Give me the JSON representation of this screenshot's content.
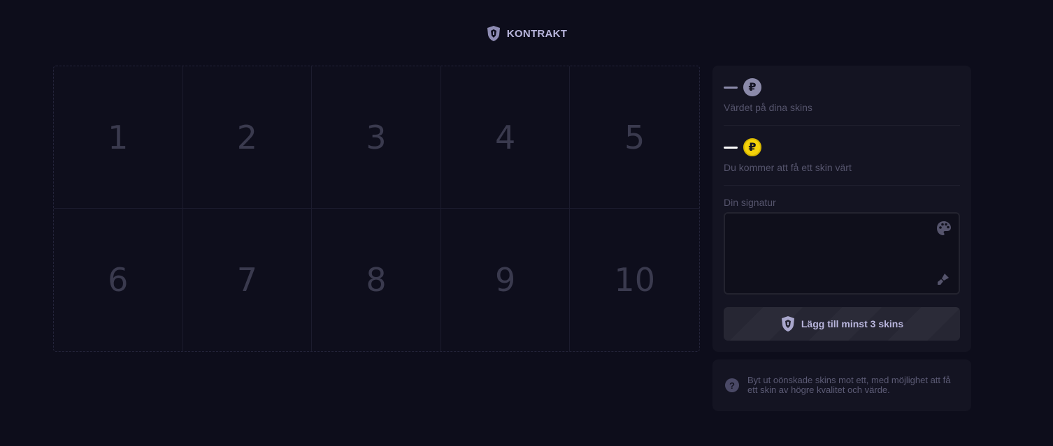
{
  "header": {
    "title": "KONTRAKT",
    "icon": "shield-icon"
  },
  "slots": [
    "1",
    "2",
    "3",
    "4",
    "5",
    "6",
    "7",
    "8",
    "9",
    "10"
  ],
  "panel": {
    "skins_value": {
      "amount": "—",
      "currency_symbol": "₽",
      "label": "Värdet på dina skins",
      "coin_color": "#8b8aaa"
    },
    "receive_value": {
      "amount": "—",
      "currency_symbol": "₽",
      "label": "Du kommer att få ett skin värt",
      "coin_color": "#f5d20a"
    },
    "signature": {
      "label": "Din signatur",
      "palette_icon": "palette-icon",
      "brush_icon": "brush-icon"
    },
    "button": {
      "label": "Lägg till minst 3 skins",
      "icon": "shield-icon"
    }
  },
  "info": {
    "icon": "help-icon",
    "help_symbol": "?",
    "text": "Byt ut oönskade skins mot ett, med möjlighet att få ett skin av högre kvalitet och värde."
  }
}
